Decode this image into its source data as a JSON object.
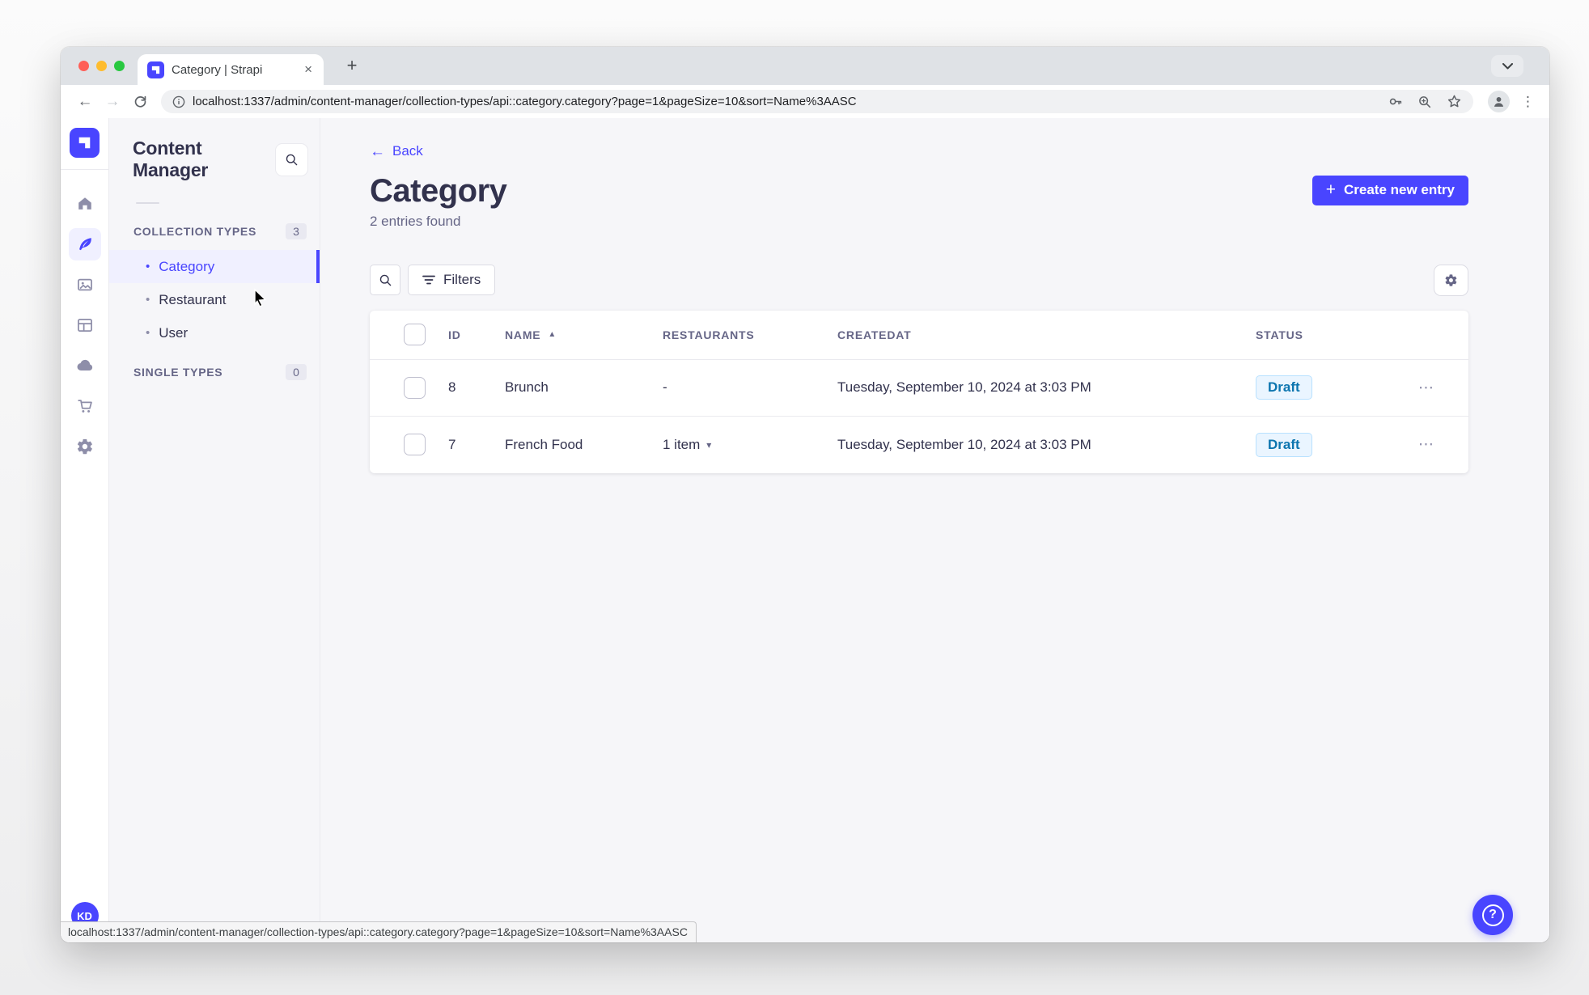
{
  "browser": {
    "tab_title": "Category | Strapi",
    "url": "localhost:1337/admin/content-manager/collection-types/api::category.category?page=1&pageSize=10&sort=Name%3AASC",
    "status_bar_url": "localhost:1337/admin/content-manager/collection-types/api::category.category?page=1&pageSize=10&sort=Name%3AASC"
  },
  "rail": {
    "avatar_initials": "KD"
  },
  "sidebar": {
    "title": "Content Manager",
    "collection_types": {
      "label": "COLLECTION TYPES",
      "count": "3",
      "items": [
        {
          "label": "Category"
        },
        {
          "label": "Restaurant"
        },
        {
          "label": "User"
        }
      ]
    },
    "single_types": {
      "label": "SINGLE TYPES",
      "count": "0"
    }
  },
  "main": {
    "back_label": "Back",
    "title": "Category",
    "subtitle": "2 entries found",
    "create_button_label": "Create new entry",
    "filters_button_label": "Filters",
    "table": {
      "headers": [
        "ID",
        "NAME",
        "RESTAURANTS",
        "CREATEDAT",
        "STATUS"
      ],
      "rows": [
        {
          "id": "8",
          "name": "Brunch",
          "restaurants": "-",
          "createdAt": "Tuesday, September 10, 2024 at 3:03 PM",
          "status": "Draft"
        },
        {
          "id": "7",
          "name": "French Food",
          "restaurants": "1 item",
          "createdAt": "Tuesday, September 10, 2024 at 3:03 PM",
          "status": "Draft"
        }
      ]
    }
  },
  "icons": {
    "close_tab": "×",
    "new_tab": "+",
    "back_nav": "←",
    "forward_nav": "→",
    "dots_vertical": "⋮",
    "dots_horizontal": "⋯",
    "sort_asc": "▲",
    "caret_down": "▾",
    "bullet": "•",
    "question": "?"
  },
  "colors": {
    "primary": "#4945ff",
    "primary_light_bg": "#f0f0ff",
    "draft_badge_bg": "#eaf5ff",
    "draft_badge_border": "#b8e1ff",
    "draft_badge_text": "#0c75af",
    "text_dark": "#32324d",
    "text_muted": "#666687"
  }
}
